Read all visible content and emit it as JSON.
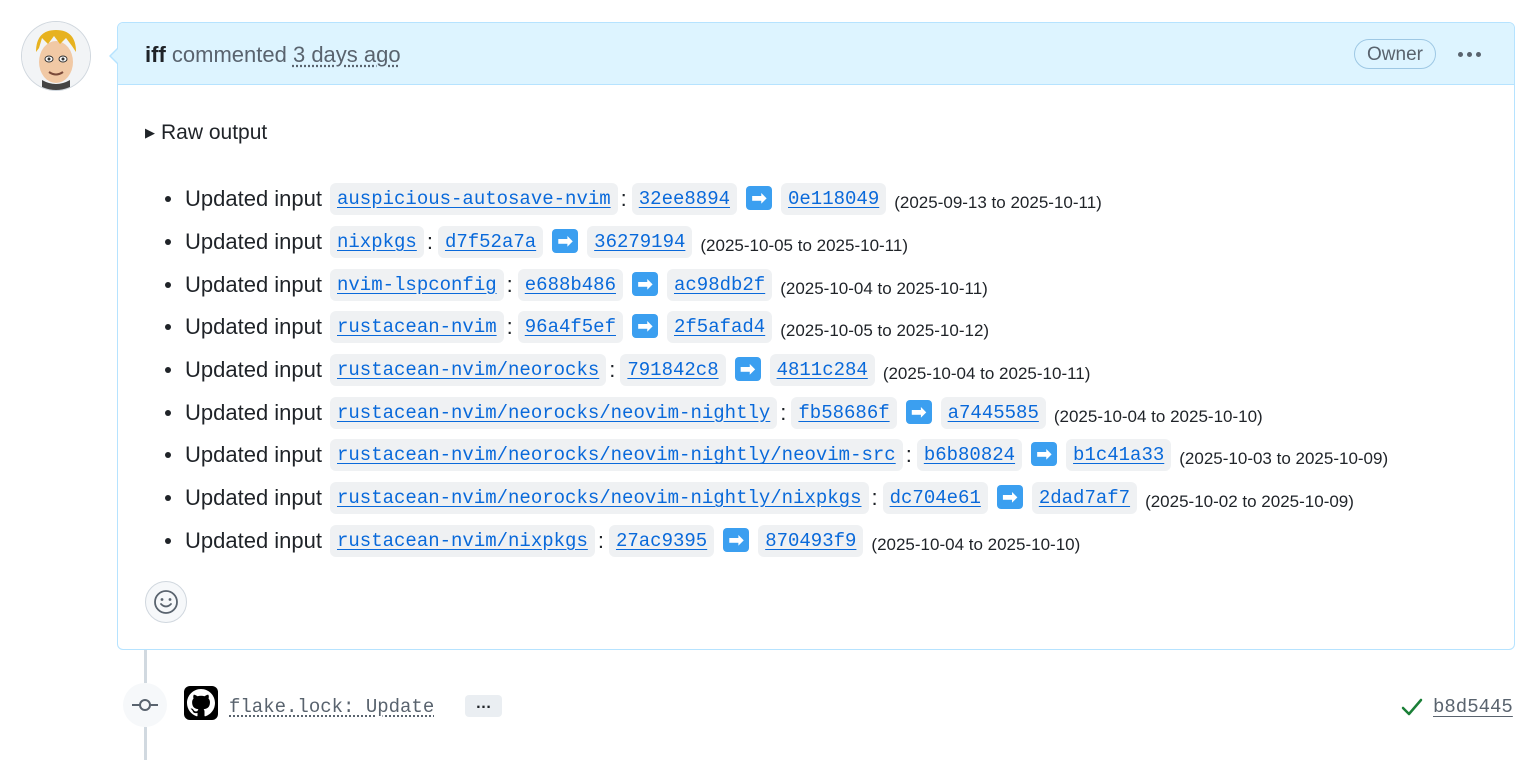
{
  "comment": {
    "author": "iff",
    "action": "commented",
    "time": "3 days ago",
    "role_badge": "Owner",
    "menu_icon": "kebab-horizontal-icon",
    "details_summary": "Raw output",
    "update_prefix": "Updated input",
    "updates": [
      {
        "input": "auspicious-autosave-nvim",
        "from": "32ee8894",
        "to": "0e118049",
        "dates": "(2025-09-13 to 2025-10-11)"
      },
      {
        "input": "nixpkgs",
        "from": "d7f52a7a",
        "to": "36279194",
        "dates": "(2025-10-05 to 2025-10-11)"
      },
      {
        "input": "nvim-lspconfig",
        "from": "e688b486",
        "to": "ac98db2f",
        "dates": "(2025-10-04 to 2025-10-11)"
      },
      {
        "input": "rustacean-nvim",
        "from": "96a4f5ef",
        "to": "2f5afad4",
        "dates": "(2025-10-05 to 2025-10-12)"
      },
      {
        "input": "rustacean-nvim/neorocks",
        "from": "791842c8",
        "to": "4811c284",
        "dates": "(2025-10-04 to 2025-10-11)"
      },
      {
        "input": "rustacean-nvim/neorocks/neovim-nightly",
        "from": "fb58686f",
        "to": "a7445585",
        "dates": "(2025-10-04 to 2025-10-10)"
      },
      {
        "input": "rustacean-nvim/neorocks/neovim-nightly/neovim-src",
        "from": "b6b80824",
        "to": "b1c41a33",
        "dates": "(2025-10-03 to 2025-10-09)"
      },
      {
        "input": "rustacean-nvim/neorocks/neovim-nightly/nixpkgs",
        "from": "dc704e61",
        "to": "2dad7af7",
        "dates": "(2025-10-02 to 2025-10-09)"
      },
      {
        "input": "rustacean-nvim/nixpkgs",
        "from": "27ac9395",
        "to": "870493f9",
        "dates": "(2025-10-04 to 2025-10-10)"
      }
    ],
    "reaction_icon": "smiley-icon"
  },
  "commit": {
    "message": "flake.lock: Update",
    "more": "…",
    "sha": "b8d5445",
    "status_icon": "check-icon"
  },
  "colors": {
    "header_bg": "#ddf4ff",
    "border": "#b6e3ff",
    "link": "#0969da",
    "success": "#1a7f37"
  }
}
